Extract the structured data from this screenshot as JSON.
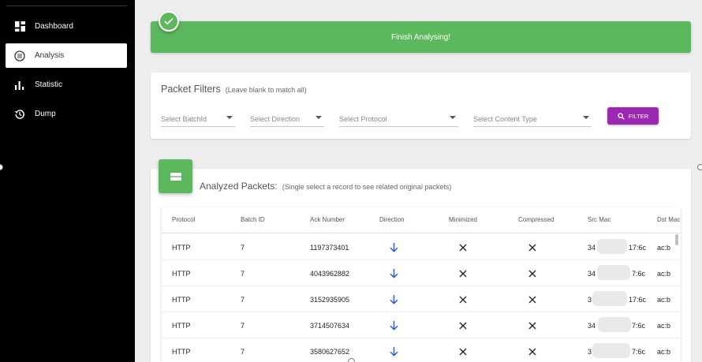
{
  "sidebar": {
    "items": [
      {
        "label": "Dashboard",
        "icon": "dashboard-icon",
        "active": false
      },
      {
        "label": "Analysis",
        "icon": "analysis-icon",
        "active": true
      },
      {
        "label": "Statistic",
        "icon": "bar-chart-icon",
        "active": false
      },
      {
        "label": "Dump",
        "icon": "history-icon",
        "active": false
      }
    ]
  },
  "banner": {
    "message": "Finish Analysing!",
    "color": "#5cb85c"
  },
  "filters": {
    "title": "Packet Filters",
    "subtitle": "(Leave blank to match all)",
    "batch_placeholder": "Select BatchId",
    "direction_placeholder": "Select Direction",
    "protocol_placeholder": "Select Protocol",
    "content_type_placeholder": "Select Content Type",
    "button_label": "FILTER",
    "button_color": "#9c27b0"
  },
  "packets": {
    "title": "Analyzed Packets:",
    "subtitle": "(Single select a record to see related original packets)",
    "columns": [
      "Protocol",
      "Batch ID",
      "Ack Number",
      "Direction",
      "Minimized",
      "Compressed",
      "Src Mac",
      "Dst Mac"
    ],
    "rows": [
      {
        "protocol": "HTTP",
        "batch_id": "7",
        "ack_number": "1197373401",
        "direction": "down",
        "minimized": "no",
        "compressed": "no",
        "src_prefix": "34",
        "src_suffix": "17:6c",
        "dst_prefix": "ac:b"
      },
      {
        "protocol": "HTTP",
        "batch_id": "7",
        "ack_number": "4043962882",
        "direction": "down",
        "minimized": "no",
        "compressed": "no",
        "src_prefix": "34",
        "src_suffix": "7:6c",
        "dst_prefix": "ac:b"
      },
      {
        "protocol": "HTTP",
        "batch_id": "7",
        "ack_number": "3152935905",
        "direction": "down",
        "minimized": "no",
        "compressed": "no",
        "src_prefix": "3",
        "src_suffix": "17:6c",
        "dst_prefix": "ac:b"
      },
      {
        "protocol": "HTTP",
        "batch_id": "7",
        "ack_number": "3714507634",
        "direction": "down",
        "minimized": "no",
        "compressed": "no",
        "src_prefix": "34",
        "src_suffix": "7:6c",
        "dst_prefix": "ac:b"
      },
      {
        "protocol": "HTTP",
        "batch_id": "7",
        "ack_number": "3580627652",
        "direction": "down",
        "minimized": "no",
        "compressed": "no",
        "src_prefix": "3",
        "src_suffix": "7:6c",
        "dst_prefix": "ac:b"
      }
    ]
  }
}
